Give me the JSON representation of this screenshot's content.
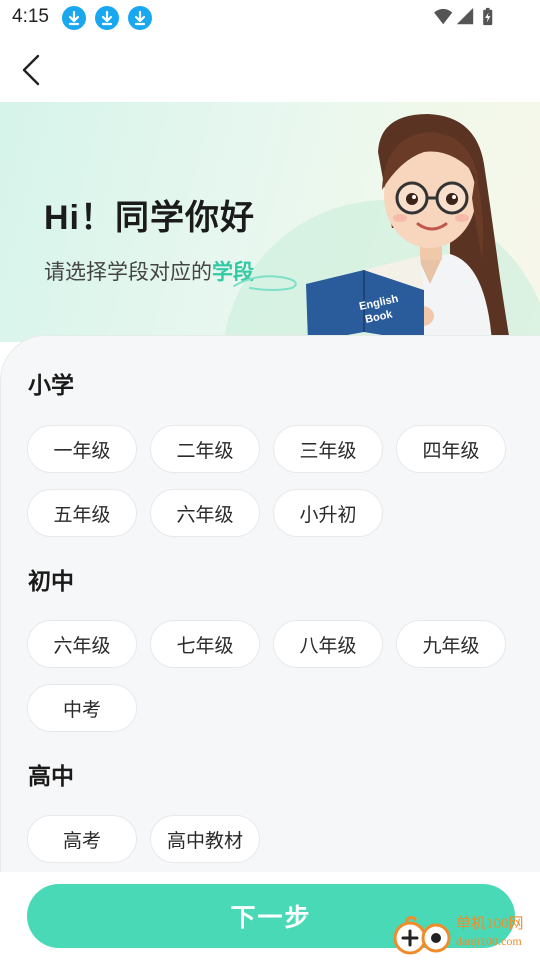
{
  "status_bar": {
    "time": "4:15",
    "download_notifications": [
      "download-icon",
      "download-icon",
      "download-icon"
    ],
    "system_icons": [
      "wifi-icon",
      "signal-icon",
      "battery-charging-icon"
    ]
  },
  "nav": {
    "back_icon": "chevron-left-icon"
  },
  "hero": {
    "title": "Hi！同学你好",
    "subtitle_prefix": "请选择学段对应的",
    "subtitle_accent": "学段",
    "book_text_line1": "English",
    "book_text_line2": "Book"
  },
  "sections": [
    {
      "title": "小学",
      "grades": [
        "一年级",
        "二年级",
        "三年级",
        "四年级",
        "五年级",
        "六年级",
        "小升初"
      ]
    },
    {
      "title": "初中",
      "grades": [
        "六年级",
        "七年级",
        "八年级",
        "九年级",
        "中考"
      ]
    },
    {
      "title": "高中",
      "grades": [
        "高考",
        "高中教材"
      ]
    }
  ],
  "next_button": {
    "label": "下一步"
  },
  "watermark": {
    "text": "单机100网",
    "url": "danji100.com"
  },
  "colors": {
    "accent": "#4ad9b7",
    "accent_text": "#33c9a3",
    "status_download": "#19a8f0",
    "card_background": "#f6f7f8",
    "watermark": "#f08c2a"
  }
}
